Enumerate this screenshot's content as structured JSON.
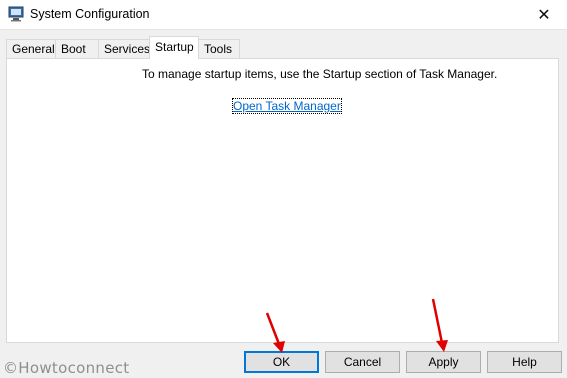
{
  "window": {
    "title": "System Configuration",
    "close_glyph": "✕"
  },
  "tabs": [
    {
      "label": "General"
    },
    {
      "label": "Boot"
    },
    {
      "label": "Services"
    },
    {
      "label": "Startup",
      "active": true
    },
    {
      "label": "Tools"
    }
  ],
  "panel": {
    "message": "To manage startup items, use the Startup section of Task Manager.",
    "link": "Open Task Manager"
  },
  "buttons": {
    "ok": "OK",
    "cancel": "Cancel",
    "apply": "Apply",
    "help": "Help"
  },
  "watermark": "©Howtoconnect",
  "icons": {
    "app": "system-config-icon",
    "arrow": "red-arrow-icon"
  },
  "colors": {
    "accent": "#0078d7",
    "link": "#0066cc",
    "arrow": "#e00000"
  }
}
